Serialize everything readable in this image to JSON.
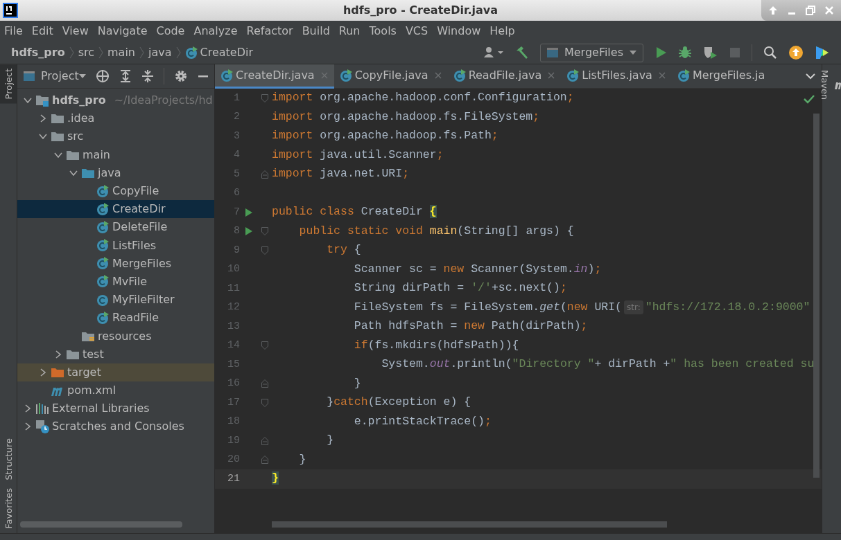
{
  "window": {
    "title": "hdfs_pro - CreateDir.java"
  },
  "menu": [
    "File",
    "Edit",
    "View",
    "Navigate",
    "Code",
    "Analyze",
    "Refactor",
    "Build",
    "Run",
    "Tools",
    "VCS",
    "Window",
    "Help"
  ],
  "breadcrumb": [
    {
      "label": "hdfs_pro",
      "kind": "project"
    },
    {
      "label": "src",
      "kind": "folder"
    },
    {
      "label": "main",
      "kind": "folder"
    },
    {
      "label": "java",
      "kind": "folder"
    },
    {
      "label": "CreateDir",
      "kind": "class"
    }
  ],
  "toolbar": {
    "run_configuration": "MergeFiles",
    "stop_enabled": false
  },
  "left_stripe": [
    {
      "label": "Project",
      "selected": true,
      "kind": "top"
    },
    {
      "label": "Structure",
      "selected": false,
      "kind": "bottom"
    },
    {
      "label": "Favorites",
      "selected": false,
      "kind": "bottom"
    }
  ],
  "project_panel": {
    "title": "Project",
    "tree": [
      {
        "label": "hdfs_pro",
        "kind": "project",
        "hint": "~/IdeaProjects/hd",
        "expanded": true,
        "selected": false,
        "children": [
          {
            "label": ".idea",
            "kind": "folder",
            "expanded": false,
            "selected": false
          },
          {
            "label": "src",
            "kind": "folder",
            "expanded": true,
            "selected": false,
            "children": [
              {
                "label": "main",
                "kind": "folder",
                "expanded": true,
                "selected": false,
                "children": [
                  {
                    "label": "java",
                    "kind": "source-folder",
                    "expanded": true,
                    "selected": false,
                    "children": [
                      {
                        "label": "CopyFile",
                        "kind": "runnable-class",
                        "selected": false
                      },
                      {
                        "label": "CreateDir",
                        "kind": "runnable-class",
                        "selected": true
                      },
                      {
                        "label": "DeleteFile",
                        "kind": "runnable-class",
                        "selected": false
                      },
                      {
                        "label": "ListFiles",
                        "kind": "runnable-class",
                        "selected": false
                      },
                      {
                        "label": "MergeFiles",
                        "kind": "runnable-class",
                        "selected": false
                      },
                      {
                        "label": "MvFile",
                        "kind": "runnable-class",
                        "selected": false
                      },
                      {
                        "label": "MyFileFilter",
                        "kind": "class",
                        "selected": false
                      },
                      {
                        "label": "ReadFile",
                        "kind": "runnable-class",
                        "selected": false
                      }
                    ]
                  },
                  {
                    "label": "resources",
                    "kind": "resources-folder",
                    "selected": false
                  }
                ]
              },
              {
                "label": "test",
                "kind": "folder",
                "expanded": false,
                "selected": false
              }
            ]
          },
          {
            "label": "target",
            "kind": "excluded-folder",
            "expanded": false,
            "selected": false
          },
          {
            "label": "pom.xml",
            "kind": "maven",
            "selected": false
          }
        ]
      },
      {
        "label": "External Libraries",
        "kind": "libraries",
        "expanded": false,
        "selected": false
      },
      {
        "label": "Scratches and Consoles",
        "kind": "scratches",
        "expanded": false,
        "selected": false
      }
    ]
  },
  "editor": {
    "tabs": [
      {
        "label": "CreateDir.java",
        "selected": true,
        "closable": true
      },
      {
        "label": "CopyFile.java",
        "selected": false,
        "closable": true
      },
      {
        "label": "ReadFile.java",
        "selected": false,
        "closable": true
      },
      {
        "label": "ListFiles.java",
        "selected": false,
        "closable": true
      },
      {
        "label": "MergeFiles.ja",
        "selected": false,
        "closable": false
      }
    ],
    "lines": [
      {
        "number": "1",
        "kind": "fold-start",
        "tokens": [
          {
            "kind": "keyword",
            "text": "import "
          },
          {
            "kind": "plain",
            "text": "org.apache.hadoop.conf.Configuration"
          },
          {
            "kind": "keyword",
            "text": ";"
          }
        ]
      },
      {
        "number": "2",
        "tokens": [
          {
            "kind": "keyword",
            "text": "import "
          },
          {
            "kind": "plain",
            "text": "org.apache.hadoop.fs.FileSystem"
          },
          {
            "kind": "keyword",
            "text": ";"
          }
        ]
      },
      {
        "number": "3",
        "tokens": [
          {
            "kind": "keyword",
            "text": "import "
          },
          {
            "kind": "plain",
            "text": "org.apache.hadoop.fs.Path"
          },
          {
            "kind": "keyword",
            "text": ";"
          }
        ]
      },
      {
        "number": "4",
        "tokens": [
          {
            "kind": "keyword",
            "text": "import "
          },
          {
            "kind": "plain",
            "text": "java.util.Scanner"
          },
          {
            "kind": "keyword",
            "text": ";"
          }
        ]
      },
      {
        "number": "5",
        "kind": "fold-end",
        "tokens": [
          {
            "kind": "keyword",
            "text": "import "
          },
          {
            "kind": "plain",
            "text": "java.net.URI"
          },
          {
            "kind": "keyword",
            "text": ";"
          }
        ]
      },
      {
        "number": "6"
      },
      {
        "number": "7",
        "run": true,
        "tokens": [
          {
            "kind": "keyword",
            "text": "public class "
          },
          {
            "kind": "plain",
            "text": "CreateDir "
          },
          {
            "kind": "brace",
            "text": "{"
          }
        ]
      },
      {
        "number": "8",
        "run": true,
        "kind": "fold-start",
        "tokens": [
          {
            "kind": "keyword",
            "text": "    public static void "
          },
          {
            "kind": "method",
            "text": "main"
          },
          {
            "kind": "plain",
            "text": "(String[] args) {"
          }
        ]
      },
      {
        "number": "9",
        "kind": "fold-start",
        "tokens": [
          {
            "kind": "keyword",
            "text": "        try"
          },
          {
            "kind": "plain",
            "text": " {"
          }
        ]
      },
      {
        "number": "10",
        "tokens": [
          {
            "kind": "plain",
            "text": "            Scanner sc = "
          },
          {
            "kind": "keyword",
            "text": "new "
          },
          {
            "kind": "plain",
            "text": "Scanner(System."
          },
          {
            "kind": "field",
            "text": "in"
          },
          {
            "kind": "plain",
            "text": ")"
          },
          {
            "kind": "keyword",
            "text": ";"
          }
        ]
      },
      {
        "number": "11",
        "tokens": [
          {
            "kind": "plain",
            "text": "            String dirPath = "
          },
          {
            "kind": "string",
            "text": "'/'"
          },
          {
            "kind": "plain",
            "text": "+sc.next()"
          },
          {
            "kind": "keyword",
            "text": ";"
          }
        ]
      },
      {
        "number": "12",
        "tokens": [
          {
            "kind": "plain",
            "text": "            FileSystem fs = FileSystem."
          },
          {
            "kind": "static",
            "text": "get"
          },
          {
            "kind": "plain",
            "text": "("
          },
          {
            "kind": "keyword",
            "text": "new "
          },
          {
            "kind": "plain",
            "text": "URI("
          },
          {
            "kind": "hint",
            "text": "str:"
          },
          {
            "kind": "string",
            "text": "\"hdfs://172.18.0.2:9000\""
          }
        ]
      },
      {
        "number": "13",
        "tokens": [
          {
            "kind": "plain",
            "text": "            Path hdfsPath = "
          },
          {
            "kind": "keyword",
            "text": "new "
          },
          {
            "kind": "plain",
            "text": "Path(dirPath)"
          },
          {
            "kind": "keyword",
            "text": ";"
          }
        ]
      },
      {
        "number": "14",
        "kind": "fold-start",
        "tokens": [
          {
            "kind": "keyword",
            "text": "            if"
          },
          {
            "kind": "plain",
            "text": "(fs.mkdirs(hdfsPath)){"
          }
        ]
      },
      {
        "number": "15",
        "tokens": [
          {
            "kind": "plain",
            "text": "                System."
          },
          {
            "kind": "field",
            "text": "out"
          },
          {
            "kind": "plain",
            "text": ".println("
          },
          {
            "kind": "string",
            "text": "\"Directory \""
          },
          {
            "kind": "plain",
            "text": "+ dirPath +"
          },
          {
            "kind": "string",
            "text": "\" has been created su"
          }
        ]
      },
      {
        "number": "16",
        "kind": "fold-end",
        "tokens": [
          {
            "kind": "plain",
            "text": "            }"
          }
        ]
      },
      {
        "number": "17",
        "kind": "fold-start",
        "tokens": [
          {
            "kind": "plain",
            "text": "        }"
          },
          {
            "kind": "keyword",
            "text": "catch"
          },
          {
            "kind": "plain",
            "text": "(Exception e) {"
          }
        ]
      },
      {
        "number": "18",
        "tokens": [
          {
            "kind": "plain",
            "text": "            e.printStackTrace()"
          },
          {
            "kind": "keyword",
            "text": ";"
          }
        ]
      },
      {
        "number": "19",
        "kind": "fold-end",
        "tokens": [
          {
            "kind": "plain",
            "text": "        }"
          }
        ]
      },
      {
        "number": "20",
        "kind": "fold-end",
        "tokens": [
          {
            "kind": "plain",
            "text": "    }"
          }
        ]
      },
      {
        "number": "21",
        "current": true,
        "tokens": [
          {
            "kind": "brace",
            "text": "}"
          }
        ]
      }
    ]
  },
  "right_stripe": [
    {
      "label": "Maven"
    }
  ]
}
